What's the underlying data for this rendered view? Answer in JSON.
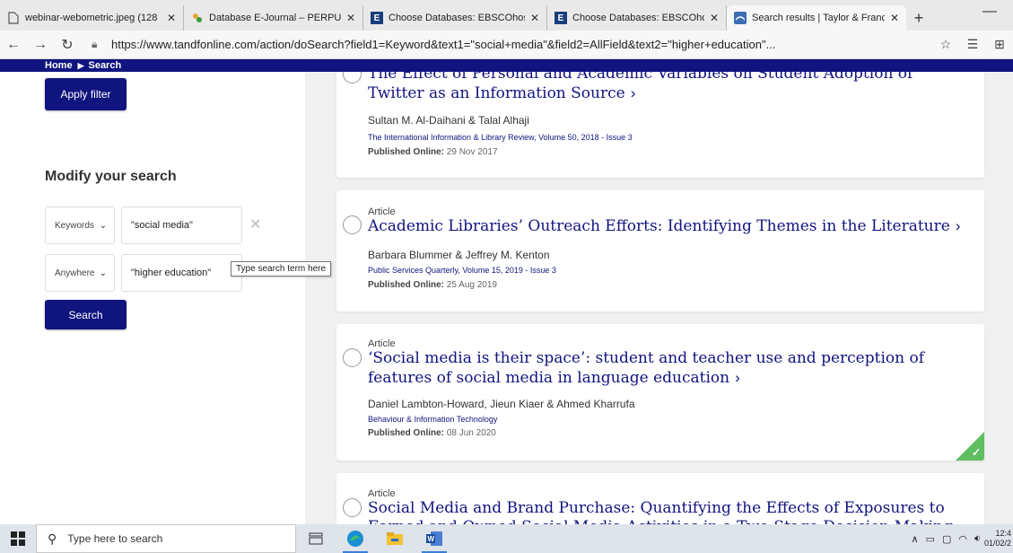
{
  "browser": {
    "tabs": [
      {
        "title": "webinar-webometric.jpeg (128",
        "icon": "file-icon"
      },
      {
        "title": "Database E-Journal – PERPUST",
        "icon": "library-icon"
      },
      {
        "title": "Choose Databases: EBSCOhost",
        "icon": "ebsco-icon",
        "favicon_text": "E"
      },
      {
        "title": "Choose Databases: EBSCOhost",
        "icon": "ebsco-icon",
        "favicon_text": "E"
      },
      {
        "title": "Search results | Taylor & Franc",
        "icon": "tandf-icon",
        "active": true
      }
    ],
    "new_tab": "+",
    "minimize": "—",
    "url": "https://www.tandfonline.com/action/doSearch?field1=Keyword&text1=\"social+media\"&field2=AllField&text2=\"higher+education\"..."
  },
  "breadcrumb": {
    "home": "Home",
    "current": "Search"
  },
  "sidebar": {
    "apply_filter": "Apply filter",
    "modify_title": "Modify your search",
    "rows": [
      {
        "field": "Keywords",
        "term": "\"social media\""
      },
      {
        "field": "Anywhere",
        "term": "\"higher education\""
      }
    ],
    "tooltip": "Type search term here",
    "search_button": "Search"
  },
  "results": [
    {
      "type": "",
      "title": "The Effect of Personal and Academic Variables on Student Adoption of Twitter as an Information Source",
      "authors": "Sultan M. Al-Daihani & Talal Alhaji",
      "journal": "The International Information & Library Review, Volume 50, 2018 - Issue 3",
      "published_label": "Published Online:",
      "published_date": "29 Nov 2017"
    },
    {
      "type": "Article",
      "title": "Academic Libraries’ Outreach Efforts: Identifying Themes in the Literature",
      "authors": "Barbara Blummer & Jeffrey M. Kenton",
      "journal": "Public Services Quarterly, Volume 15, 2019 - Issue 3",
      "published_label": "Published Online:",
      "published_date": "25 Aug 2019"
    },
    {
      "type": "Article",
      "title": "‘Social media is their space’: student and teacher use and perception of features of social media in language education",
      "authors": "Daniel Lambton-Howard, Jieun Kiaer & Ahmed Kharrufa",
      "journal": "Behaviour & Information Technology",
      "published_label": "Published Online:",
      "published_date": "08 Jun 2020",
      "open_access": true
    },
    {
      "type": "Article",
      "title": "Social Media and Brand Purchase: Quantifying the Effects of Exposures to Earned and Owned Social Media Activities in a Two-Stage Decision Making"
    }
  ],
  "taskbar": {
    "search_placeholder": "Type here to search",
    "time": "12:4",
    "date": "01/02/2"
  },
  "colors": {
    "navy": "#10147e",
    "open_access_green": "#5fbe5f"
  }
}
